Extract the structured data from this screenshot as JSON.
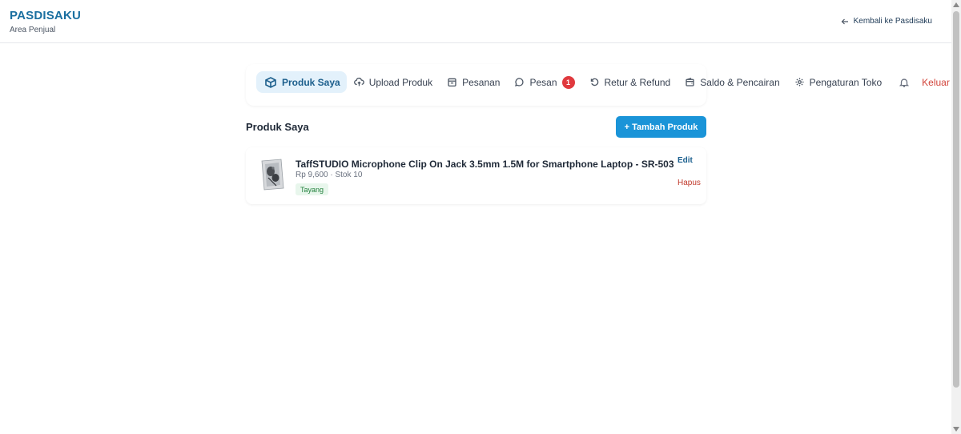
{
  "header": {
    "brand": "PASDISAKU",
    "subtitle": "Area Penjual",
    "back_link": "Kembali ke Pasdisaku"
  },
  "nav": {
    "items": [
      {
        "label": "Produk Saya",
        "icon": "box-icon",
        "active": true
      },
      {
        "label": "Upload Produk",
        "icon": "cloud-upload-icon"
      },
      {
        "label": "Pesanan",
        "icon": "calendar-icon"
      },
      {
        "label": "Pesan",
        "icon": "chat-bubble-icon",
        "badge": "1"
      },
      {
        "label": "Retur & Refund",
        "icon": "rotate-ccw-icon"
      },
      {
        "label": "Saldo & Pencairan",
        "icon": "wallet-icon"
      },
      {
        "label": "Pengaturan Toko",
        "icon": "gear-icon"
      }
    ],
    "bell_icon": "bell-icon",
    "logout": "Keluar"
  },
  "main": {
    "title": "Produk Saya",
    "add_button": "+ Tambah Produk"
  },
  "products": [
    {
      "name": "TaffSTUDIO Microphone Clip On Jack 3.5mm 1.5M for Smartphone Laptop - SR-503",
      "meta": "Rp 9,600 · Stok 10",
      "status": "Tayang",
      "edit": "Edit",
      "delete": "Hapus"
    }
  ],
  "colors": {
    "brand": "#1a6fa0",
    "accent": "#1a94d8",
    "active_bg": "#e3f1fb",
    "badge": "#e0393e",
    "logout": "#d2443a",
    "status_bg": "#e8f6ec",
    "status_text": "#23803d"
  }
}
